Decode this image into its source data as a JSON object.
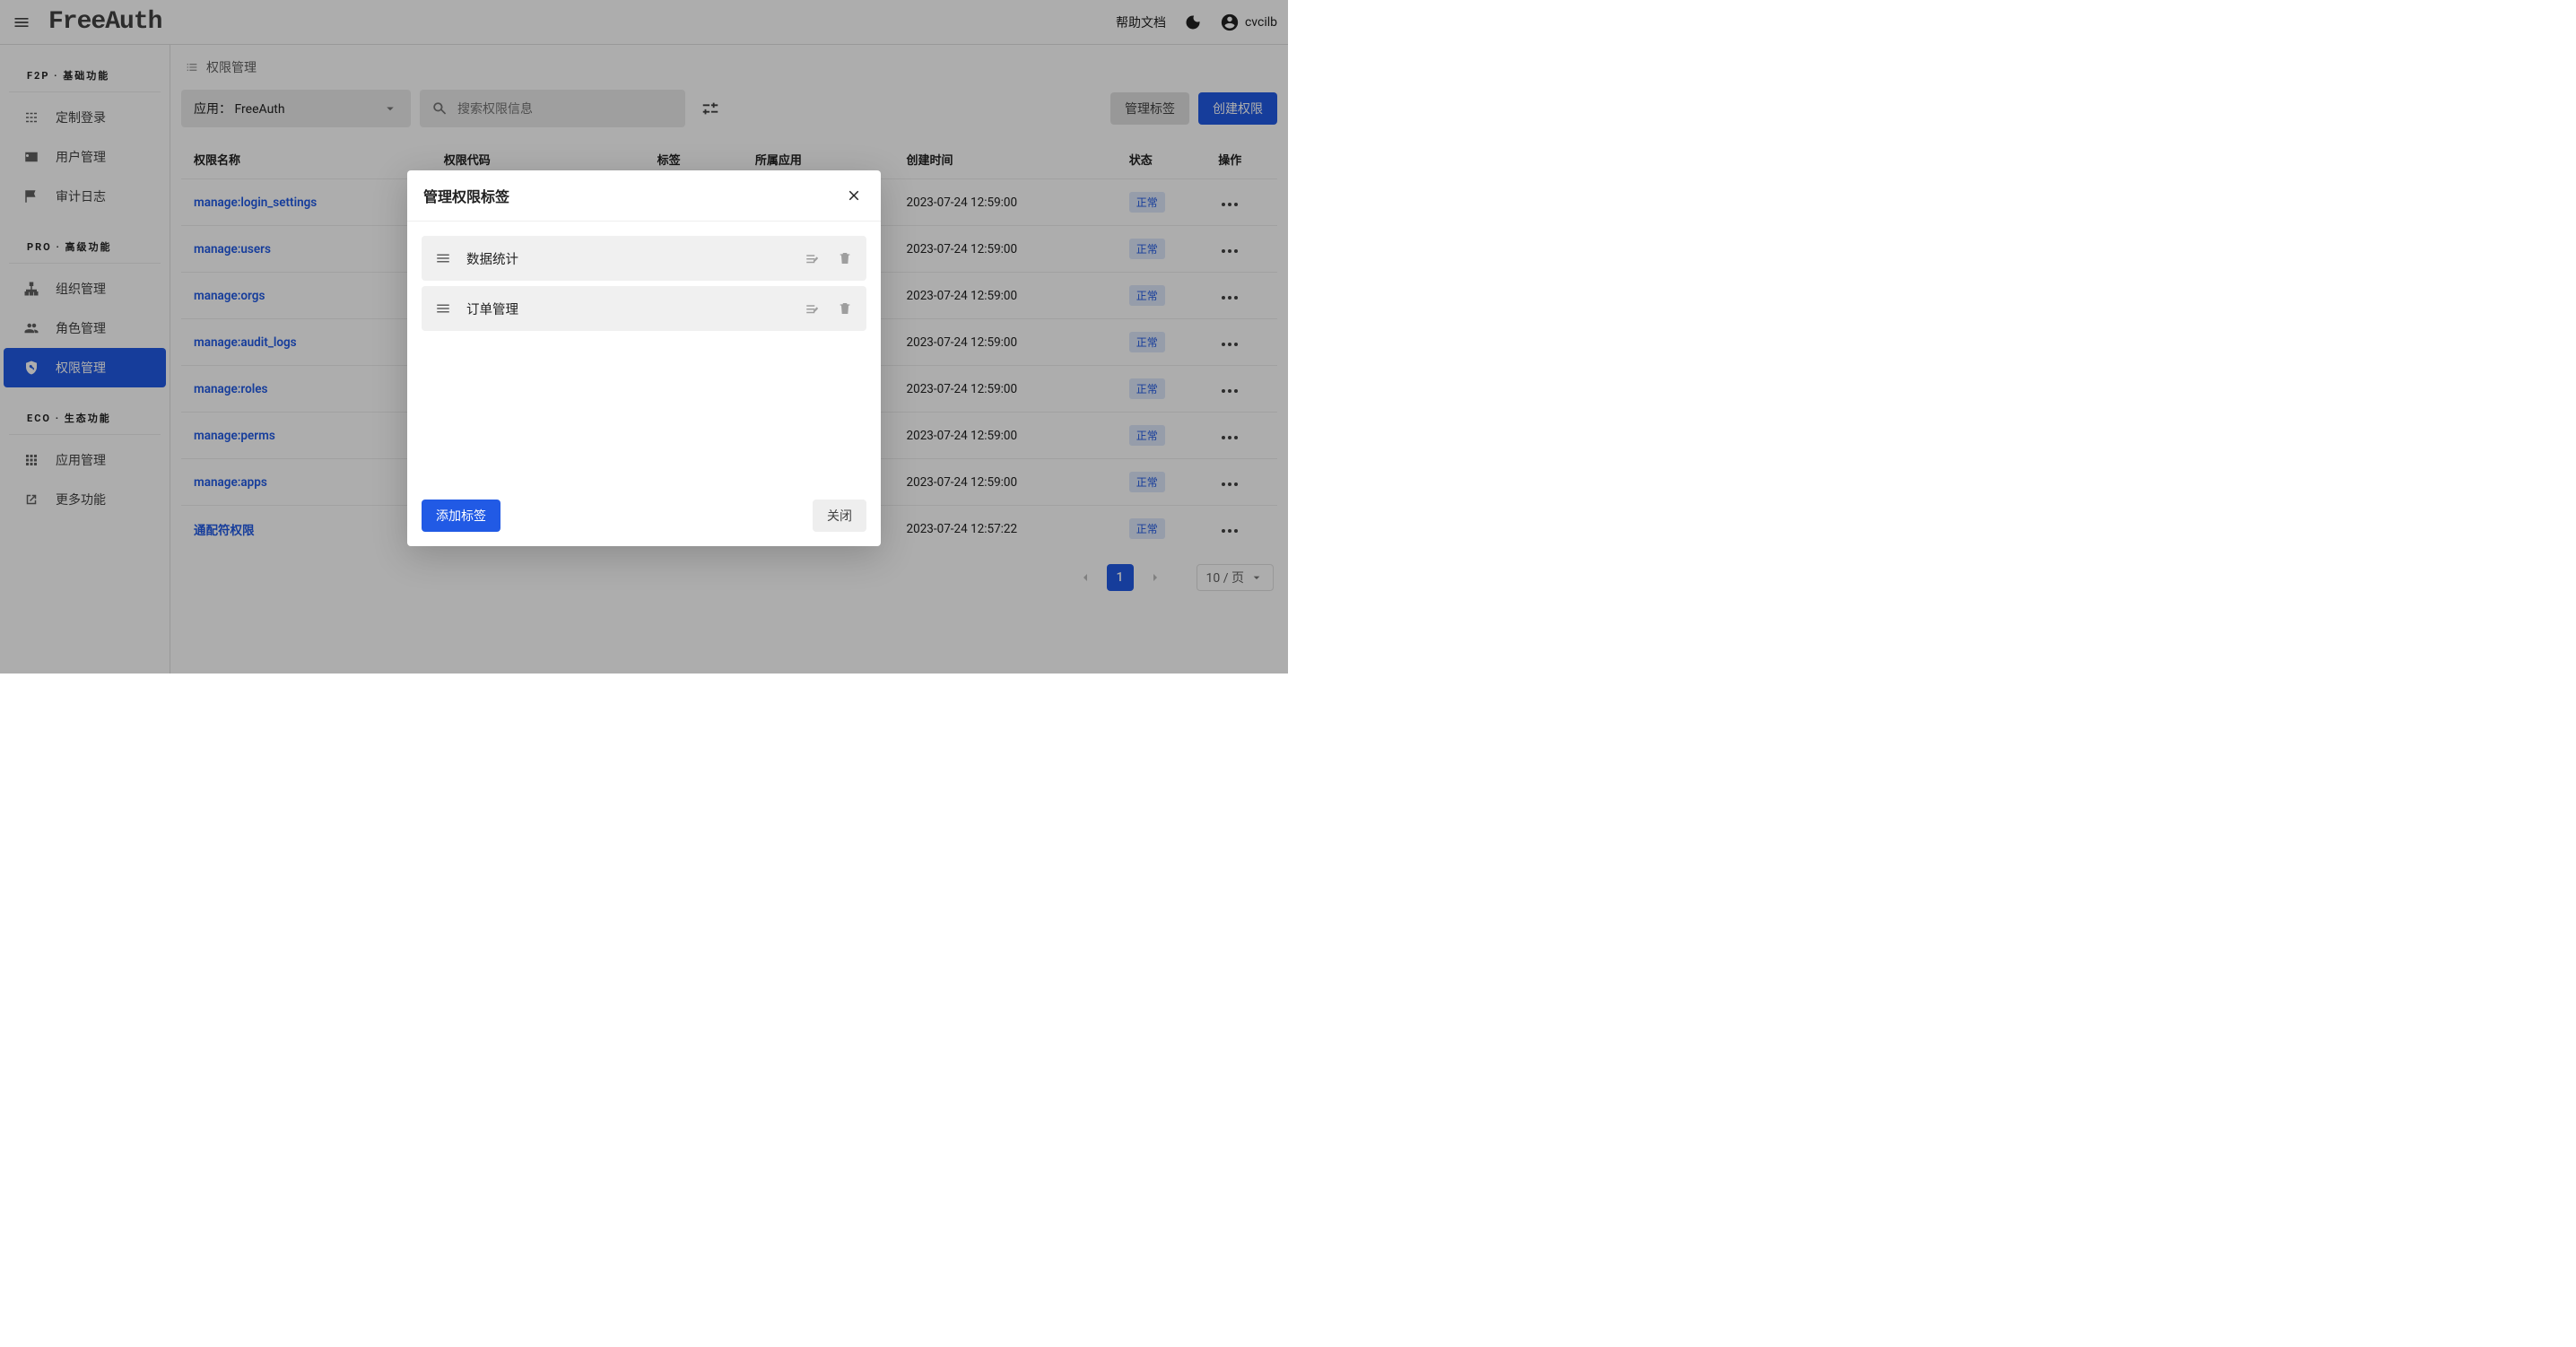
{
  "header": {
    "logo": "FreeAuth",
    "help_link": "帮助文档",
    "username": "cvcilb"
  },
  "sidebar": {
    "groups": [
      {
        "label": "F2P · 基础功能",
        "items": [
          {
            "id": "custom-login",
            "label": "定制登录"
          },
          {
            "id": "users",
            "label": "用户管理"
          },
          {
            "id": "audit-logs",
            "label": "审计日志"
          }
        ]
      },
      {
        "label": "PRO · 高级功能",
        "items": [
          {
            "id": "orgs",
            "label": "组织管理"
          },
          {
            "id": "roles",
            "label": "角色管理"
          },
          {
            "id": "perms",
            "label": "权限管理",
            "active": true
          }
        ]
      },
      {
        "label": "ECO · 生态功能",
        "items": [
          {
            "id": "apps",
            "label": "应用管理"
          },
          {
            "id": "more",
            "label": "更多功能"
          }
        ]
      }
    ]
  },
  "breadcrumb": {
    "title": "权限管理"
  },
  "toolbar": {
    "app_prefix": "应用：",
    "app_selected": "FreeAuth",
    "search_placeholder": "搜索权限信息",
    "manage_tags_label": "管理标签",
    "create_perm_label": "创建权限"
  },
  "table": {
    "columns": {
      "name": "权限名称",
      "code": "权限代码",
      "tags": "标签",
      "app": "所属应用",
      "created": "创建时间",
      "status": "状态",
      "actions": "操作"
    },
    "status_normal": "正常",
    "rows": [
      {
        "name": "manage:login_settings",
        "created": "2023-07-24 12:59:00"
      },
      {
        "name": "manage:users",
        "created": "2023-07-24 12:59:00"
      },
      {
        "name": "manage:orgs",
        "created": "2023-07-24 12:59:00"
      },
      {
        "name": "manage:audit_logs",
        "created": "2023-07-24 12:59:00"
      },
      {
        "name": "manage:roles",
        "created": "2023-07-24 12:59:00"
      },
      {
        "name": "manage:perms",
        "created": "2023-07-24 12:59:00"
      },
      {
        "name": "manage:apps",
        "created": "2023-07-24 12:59:00"
      },
      {
        "name": "通配符权限",
        "created": "2023-07-24 12:57:22"
      }
    ]
  },
  "pagination": {
    "current": "1",
    "page_size": "10 / 页"
  },
  "dialog": {
    "title": "管理权限标签",
    "tags": [
      {
        "label": "数据统计"
      },
      {
        "label": "订单管理"
      }
    ],
    "add_label": "添加标签",
    "close_label": "关闭"
  }
}
